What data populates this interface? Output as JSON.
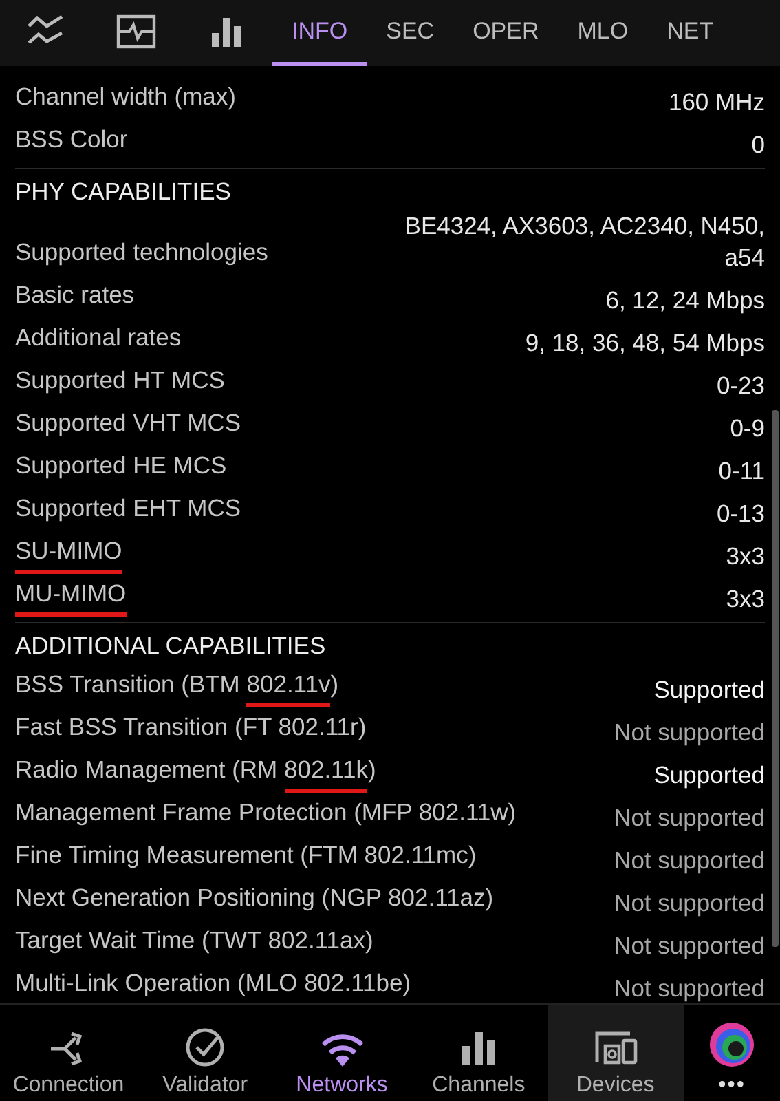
{
  "top_tabs": [
    {
      "kind": "icon",
      "selected": false
    },
    {
      "kind": "icon",
      "selected": false
    },
    {
      "kind": "icon",
      "selected": false
    },
    {
      "kind": "text",
      "label": "INFO",
      "selected": true
    },
    {
      "kind": "text",
      "label": "SEC",
      "selected": false
    },
    {
      "kind": "text",
      "label": "OPER",
      "selected": false
    },
    {
      "kind": "text",
      "label": "MLO",
      "selected": false
    },
    {
      "kind": "text",
      "label": "NET",
      "selected": false
    }
  ],
  "sections": [
    {
      "rows": [
        {
          "label": [
            {
              "text": "Channel width (max)",
              "marked": false
            }
          ],
          "value": "160 MHz"
        },
        {
          "label": [
            {
              "text": "BSS Color",
              "marked": false
            }
          ],
          "value": "0"
        }
      ]
    },
    {
      "title": "PHY CAPABILITIES",
      "rows": [
        {
          "label": [
            {
              "text": "Supported technologies",
              "marked": false
            }
          ],
          "value": "BE4324, AX3603, AC2340, N450, a54"
        },
        {
          "label": [
            {
              "text": "Basic rates",
              "marked": false
            }
          ],
          "value": "6, 12, 24 Mbps"
        },
        {
          "label": [
            {
              "text": "Additional rates",
              "marked": false
            }
          ],
          "value": "9, 18, 36, 48, 54 Mbps"
        },
        {
          "label": [
            {
              "text": "Supported HT MCS",
              "marked": false
            }
          ],
          "value": "0-23"
        },
        {
          "label": [
            {
              "text": "Supported VHT MCS",
              "marked": false
            }
          ],
          "value": "0-9"
        },
        {
          "label": [
            {
              "text": "Supported HE MCS",
              "marked": false
            }
          ],
          "value": "0-11"
        },
        {
          "label": [
            {
              "text": "Supported EHT MCS",
              "marked": false
            }
          ],
          "value": "0-13"
        },
        {
          "label": [
            {
              "text": "SU-MIMO",
              "marked": true
            }
          ],
          "value": "3x3"
        },
        {
          "label": [
            {
              "text": "MU-MIMO",
              "marked": true
            }
          ],
          "value": "3x3"
        }
      ]
    },
    {
      "title": "ADDITIONAL CAPABILITIES",
      "rows": [
        {
          "label": [
            {
              "text": "BSS Transition (BTM ",
              "marked": false
            },
            {
              "text": "802.11v",
              "marked": true
            },
            {
              "text": ")",
              "marked": false
            }
          ],
          "value": "Supported",
          "supported": true
        },
        {
          "label": [
            {
              "text": "Fast BSS Transition (FT 802.11r)",
              "marked": false
            }
          ],
          "value": "Not supported",
          "supported": false
        },
        {
          "label": [
            {
              "text": "Radio Management (RM ",
              "marked": false
            },
            {
              "text": "802.11k",
              "marked": true
            },
            {
              "text": ")",
              "marked": false
            }
          ],
          "value": "Supported",
          "supported": true
        },
        {
          "label": [
            {
              "text": "Management Frame Protection (MFP 802.11w)",
              "marked": false
            }
          ],
          "value": "Not supported",
          "supported": false
        },
        {
          "label": [
            {
              "text": "Fine Timing Measurement (FTM 802.11mc)",
              "marked": false
            }
          ],
          "value": "Not supported",
          "supported": false
        },
        {
          "label": [
            {
              "text": "Next Generation Positioning (NGP 802.11az)",
              "marked": false
            }
          ],
          "value": "Not supported",
          "supported": false
        },
        {
          "label": [
            {
              "text": "Target Wait Time (TWT 802.11ax)",
              "marked": false
            }
          ],
          "value": "Not supported",
          "supported": false
        },
        {
          "label": [
            {
              "text": "Multi-Link Operation (MLO 802.11be)",
              "marked": false
            }
          ],
          "value": "Not supported",
          "supported": false
        }
      ]
    }
  ],
  "bottom_nav": [
    {
      "label": "Connection",
      "selected": false,
      "highlighted": false
    },
    {
      "label": "Validator",
      "selected": false,
      "highlighted": false
    },
    {
      "label": "Networks",
      "selected": true,
      "highlighted": false
    },
    {
      "label": "Channels",
      "selected": false,
      "highlighted": false
    },
    {
      "label": "Devices",
      "selected": false,
      "highlighted": true
    }
  ],
  "more_label": "•••"
}
